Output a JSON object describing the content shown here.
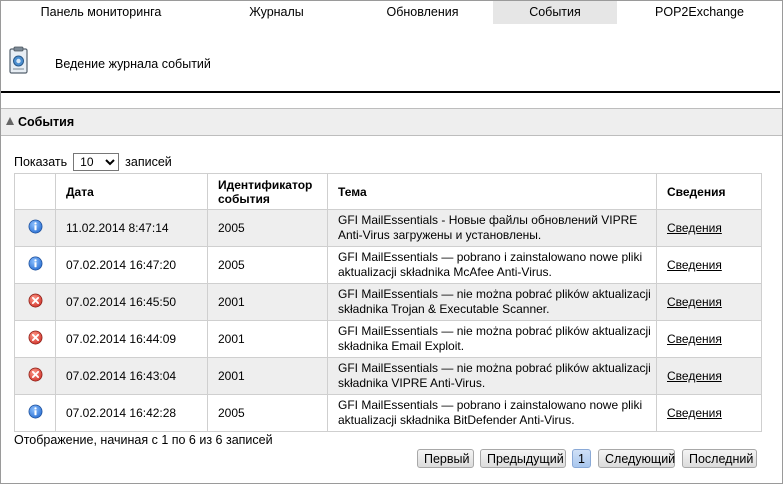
{
  "tabs": [
    {
      "label": "Панель мониторинга",
      "active": false
    },
    {
      "label": "Журналы",
      "active": false
    },
    {
      "label": "Обновления",
      "active": false
    },
    {
      "label": "События",
      "active": true
    },
    {
      "label": "POP2Exchange",
      "active": false
    }
  ],
  "header": {
    "icon": "log-clipboard-icon",
    "title": "Ведение журнала событий"
  },
  "section": {
    "label": "События"
  },
  "length_menu": {
    "before": "Показать",
    "value": "10",
    "after": "записей"
  },
  "table": {
    "headers": {
      "icon": "",
      "date": "Дата",
      "id_line1": "Идентификатор",
      "id_line2": "события",
      "subject": "Тема",
      "details": "Сведения"
    },
    "rows": [
      {
        "type": "info",
        "icon": "info-icon",
        "date": "11.02.2014 8:47:14",
        "id": "2005",
        "subject": "GFI MailEssentials - Новые файлы обновлений VIPRE Anti-Virus загружены и установлены.",
        "details": "Сведения"
      },
      {
        "type": "info",
        "icon": "info-icon",
        "date": "07.02.2014 16:47:20",
        "id": "2005",
        "subject": "GFI MailEssentials — pobrano i zainstalowano nowe pliki aktualizacji składnika McAfee Anti-Virus.",
        "details": "Сведения"
      },
      {
        "type": "error",
        "icon": "error-icon",
        "date": "07.02.2014 16:45:50",
        "id": "2001",
        "subject": "GFI MailEssentials — nie można pobrać plików aktualizacji składnika Trojan & Executable Scanner.",
        "details": "Сведения"
      },
      {
        "type": "error",
        "icon": "error-icon",
        "date": "07.02.2014 16:44:09",
        "id": "2001",
        "subject": "GFI MailEssentials — nie można pobrać plików aktualizacji składnika Email Exploit.",
        "details": "Сведения"
      },
      {
        "type": "error",
        "icon": "error-icon",
        "date": "07.02.2014 16:43:04",
        "id": "2001",
        "subject": "GFI MailEssentials — nie można pobrać plików aktualizacji składnika VIPRE Anti-Virus.",
        "details": "Сведения"
      },
      {
        "type": "info",
        "icon": "info-icon",
        "date": "07.02.2014 16:42:28",
        "id": "2005",
        "subject": "GFI MailEssentials — pobrano i zainstalowano nowe pliki aktualizacji składnika BitDefender Anti-Virus.",
        "details": "Сведения"
      }
    ]
  },
  "info_text": "Отображение, начиная с 1 по 6 из 6 записей",
  "pagination": {
    "first": "Первый",
    "previous": "Предыдущий",
    "current": "1",
    "next": "Следующий",
    "last": "Последний"
  },
  "colors": {
    "info_icon": "#2a6fd1",
    "error_icon": "#d0342c",
    "active_tab": "#e6e6e6",
    "odd_row": "#eeeeee"
  }
}
